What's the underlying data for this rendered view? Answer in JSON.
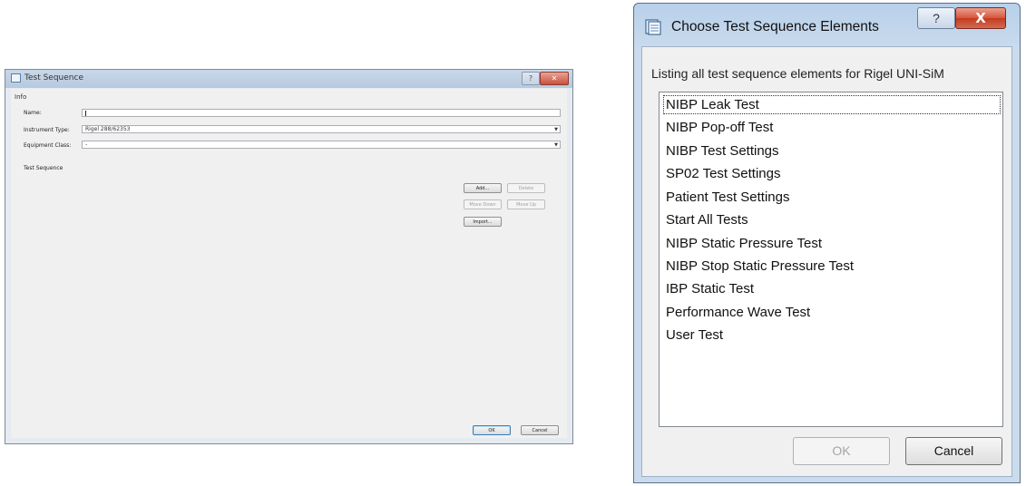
{
  "test_sequence": {
    "title": "Test Sequence",
    "close_glyph": "✕",
    "help_glyph": "?",
    "info_label": "Info",
    "name_label": "Name:",
    "name_value": "",
    "instrument_type_label": "Instrument Type:",
    "instrument_type_value": "Rigel 288/62353",
    "equipment_class_label": "Equipment Class:",
    "equipment_class_value": "-",
    "test_sequence_label": "Test Sequence",
    "buttons": {
      "add": "Add...",
      "delete": "Delete",
      "move_down": "Move Down",
      "move_up": "Move Up",
      "import": "Import..."
    },
    "ok": "OK",
    "cancel": "Cancel"
  },
  "choose_elements": {
    "title": "Choose Test Sequence Elements",
    "help_glyph": "?",
    "close_glyph": "X",
    "description": "Listing all test sequence elements for Rigel UNI-SiM",
    "items": [
      "NIBP Leak Test",
      "NIBP Pop-off Test",
      "NIBP Test Settings",
      "SP02 Test Settings",
      "Patient Test Settings",
      "Start All Tests",
      "NIBP Static Pressure Test",
      "NIBP Stop Static Pressure Test",
      "IBP Static Test",
      "Performance Wave Test",
      "User Test"
    ],
    "ok": "OK",
    "cancel": "Cancel"
  }
}
